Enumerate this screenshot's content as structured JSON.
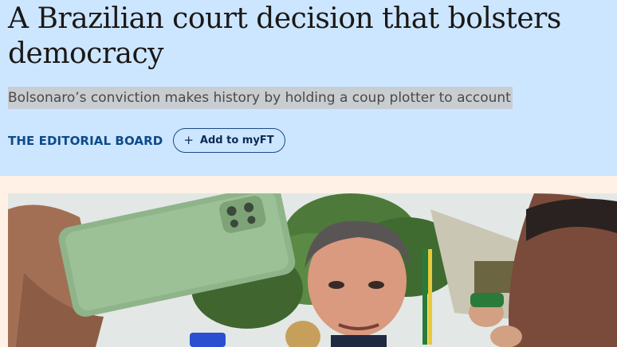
{
  "article": {
    "headline": "A Brazilian court decision that bolsters democracy",
    "standfirst": "Bolsonaro’s conviction makes history by holding a coup plotter to account",
    "author": "THE EDITORIAL BOARD",
    "myft_label": "Add to myFT",
    "myft_icon": "plus-icon"
  },
  "colors": {
    "header_background": "#cce6ff",
    "page_background": "#fff1e5",
    "author_link": "#0d4a8a",
    "standfirst_highlight": "#c8cdd2"
  }
}
